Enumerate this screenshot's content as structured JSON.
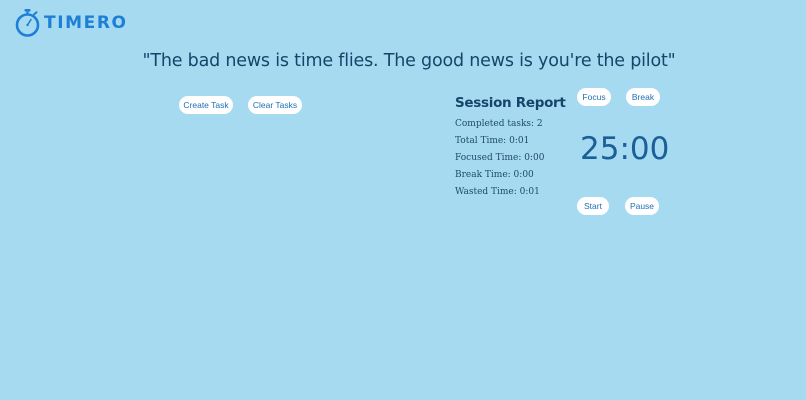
{
  "app": {
    "logo_text": "TIMERO"
  },
  "quote": "\"The bad news is time flies. The good news is you're the pilot\"",
  "tasks": {
    "create_label": "Create Task",
    "clear_label": "Clear Tasks"
  },
  "report": {
    "title": "Session Report",
    "completed": "Completed tasks: 2",
    "total": "Total Time: 0:01",
    "focused": "Focused Time: 0:00",
    "break": "Break Time: 0:00",
    "wasted": "Wasted Time: 0:01"
  },
  "timer": {
    "focus_label": "Focus",
    "break_label": "Break",
    "display": "25:00",
    "start_label": "Start",
    "pause_label": "Pause"
  },
  "icons": {
    "logo": "stopwatch-icon"
  },
  "colors": {
    "background": "#a6daf1",
    "brand": "#1e7fd6",
    "text": "#17456a",
    "button_bg": "#ffffff",
    "button_text": "#1e6fb2"
  }
}
